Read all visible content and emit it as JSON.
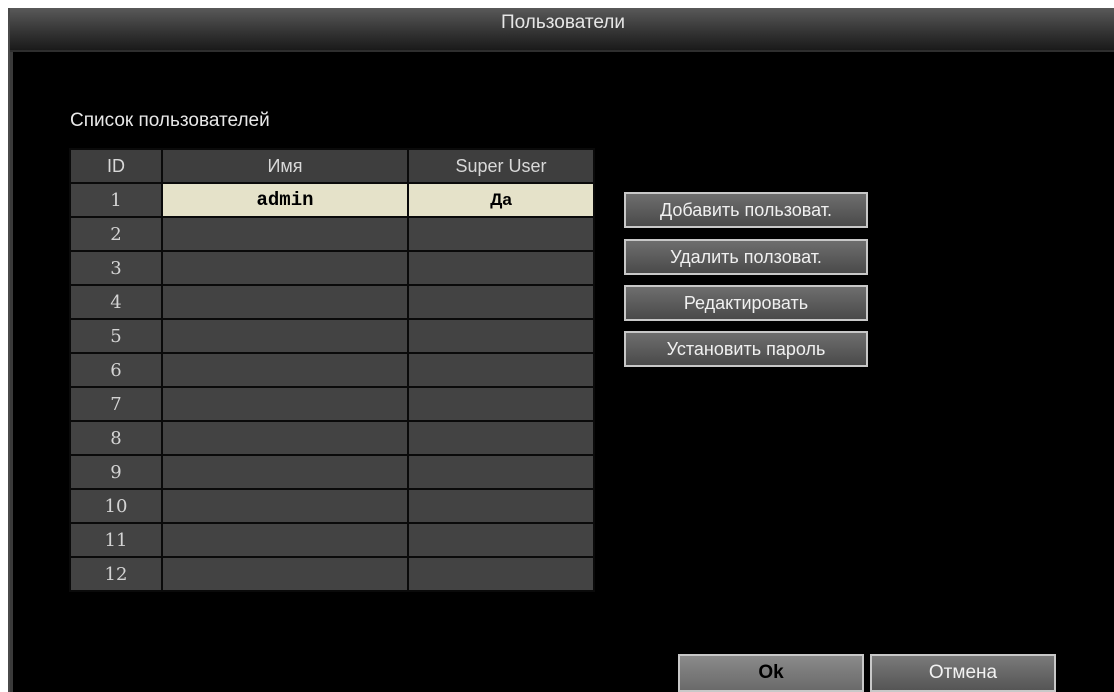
{
  "window": {
    "title": "Пользователи"
  },
  "panel": {
    "label": "Список пользователей"
  },
  "table": {
    "headers": {
      "id": "ID",
      "name": "Имя",
      "super": "Super User"
    },
    "rows": [
      {
        "id": "1",
        "name": "admin",
        "super": "Да",
        "selected": true
      },
      {
        "id": "2",
        "name": "",
        "super": ""
      },
      {
        "id": "3",
        "name": "",
        "super": ""
      },
      {
        "id": "4",
        "name": "",
        "super": ""
      },
      {
        "id": "5",
        "name": "",
        "super": ""
      },
      {
        "id": "6",
        "name": "",
        "super": ""
      },
      {
        "id": "7",
        "name": "",
        "super": ""
      },
      {
        "id": "8",
        "name": "",
        "super": ""
      },
      {
        "id": "9",
        "name": "",
        "super": ""
      },
      {
        "id": "10",
        "name": "",
        "super": ""
      },
      {
        "id": "11",
        "name": "",
        "super": ""
      },
      {
        "id": "12",
        "name": "",
        "super": ""
      }
    ]
  },
  "actions": {
    "add": "Добавить пользоват.",
    "delete": "Удалить ползоват.",
    "edit": "Редактировать",
    "set_password": "Установить пароль"
  },
  "footer": {
    "ok": "Ok",
    "cancel": "Отмена"
  },
  "colors": {
    "selected_row": "#e5e2c9",
    "cell_bg": "#434343",
    "background": "#000000"
  }
}
